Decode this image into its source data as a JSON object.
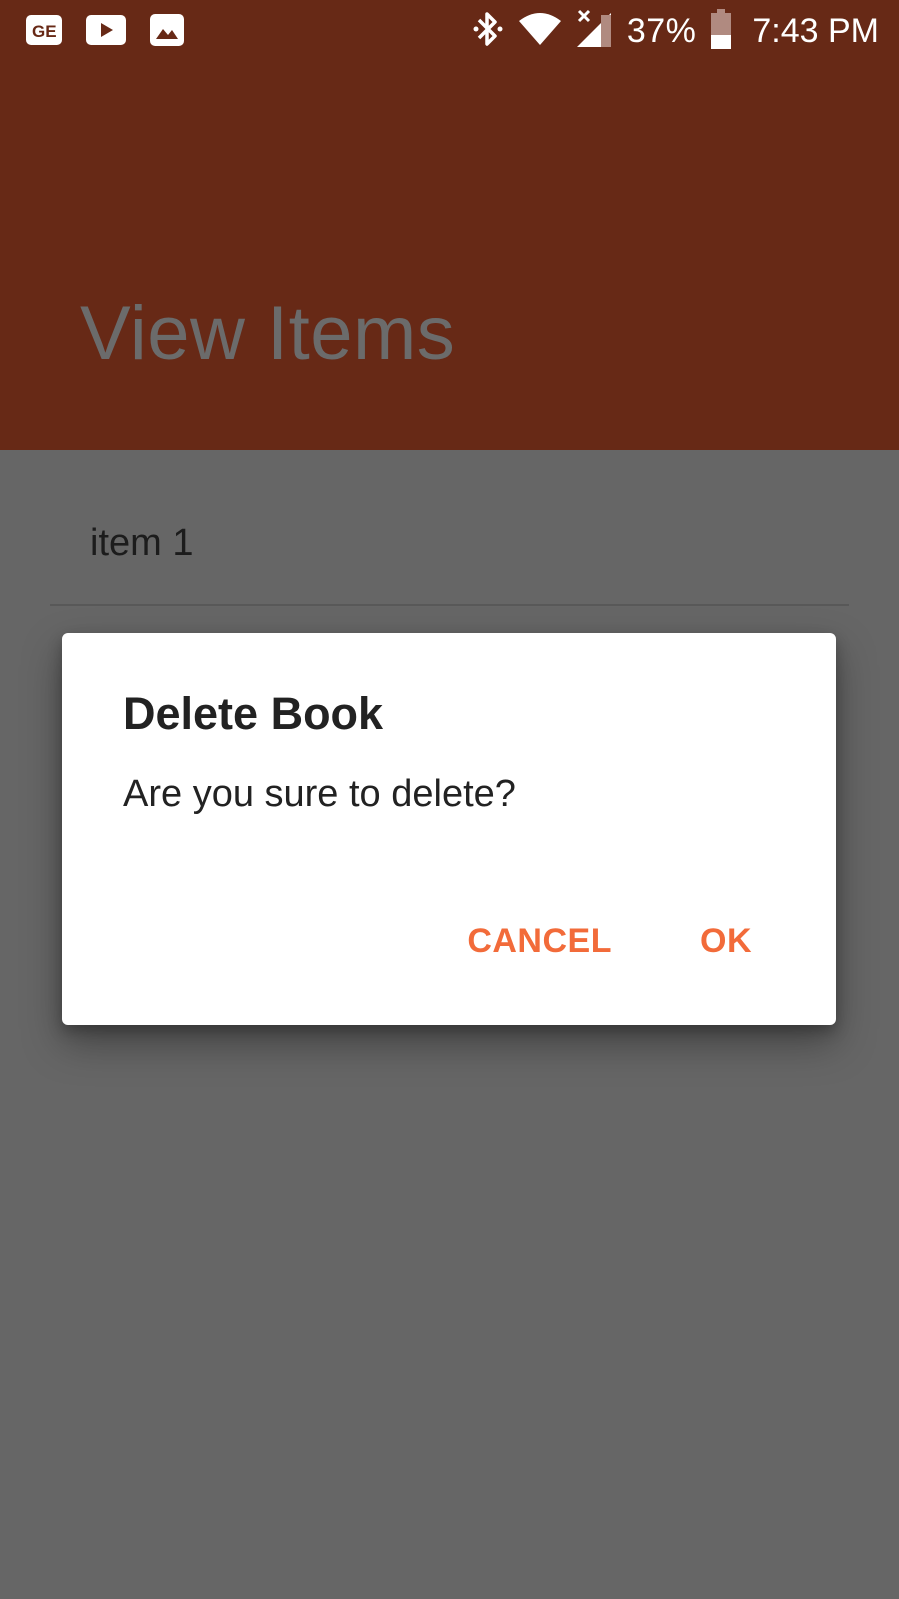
{
  "status_bar": {
    "notification_icons": [
      "ge-news-icon",
      "youtube-icon",
      "gallery-image-icon"
    ],
    "system_icons": [
      "bluetooth-icon",
      "wifi-icon",
      "cell-signal-icon"
    ],
    "battery_percent": "37%",
    "time": "7:43 PM"
  },
  "app_bar": {
    "title": "View Items",
    "color": "#672916"
  },
  "list": {
    "items": [
      {
        "label": "item 1"
      }
    ]
  },
  "dialog": {
    "title": "Delete Book",
    "message": "Are you sure to delete?",
    "cancel_label": "CANCEL",
    "ok_label": "OK",
    "accent_color": "#f26b3a"
  },
  "colors": {
    "scrim": "#666666",
    "dialog_bg": "#ffffff"
  }
}
